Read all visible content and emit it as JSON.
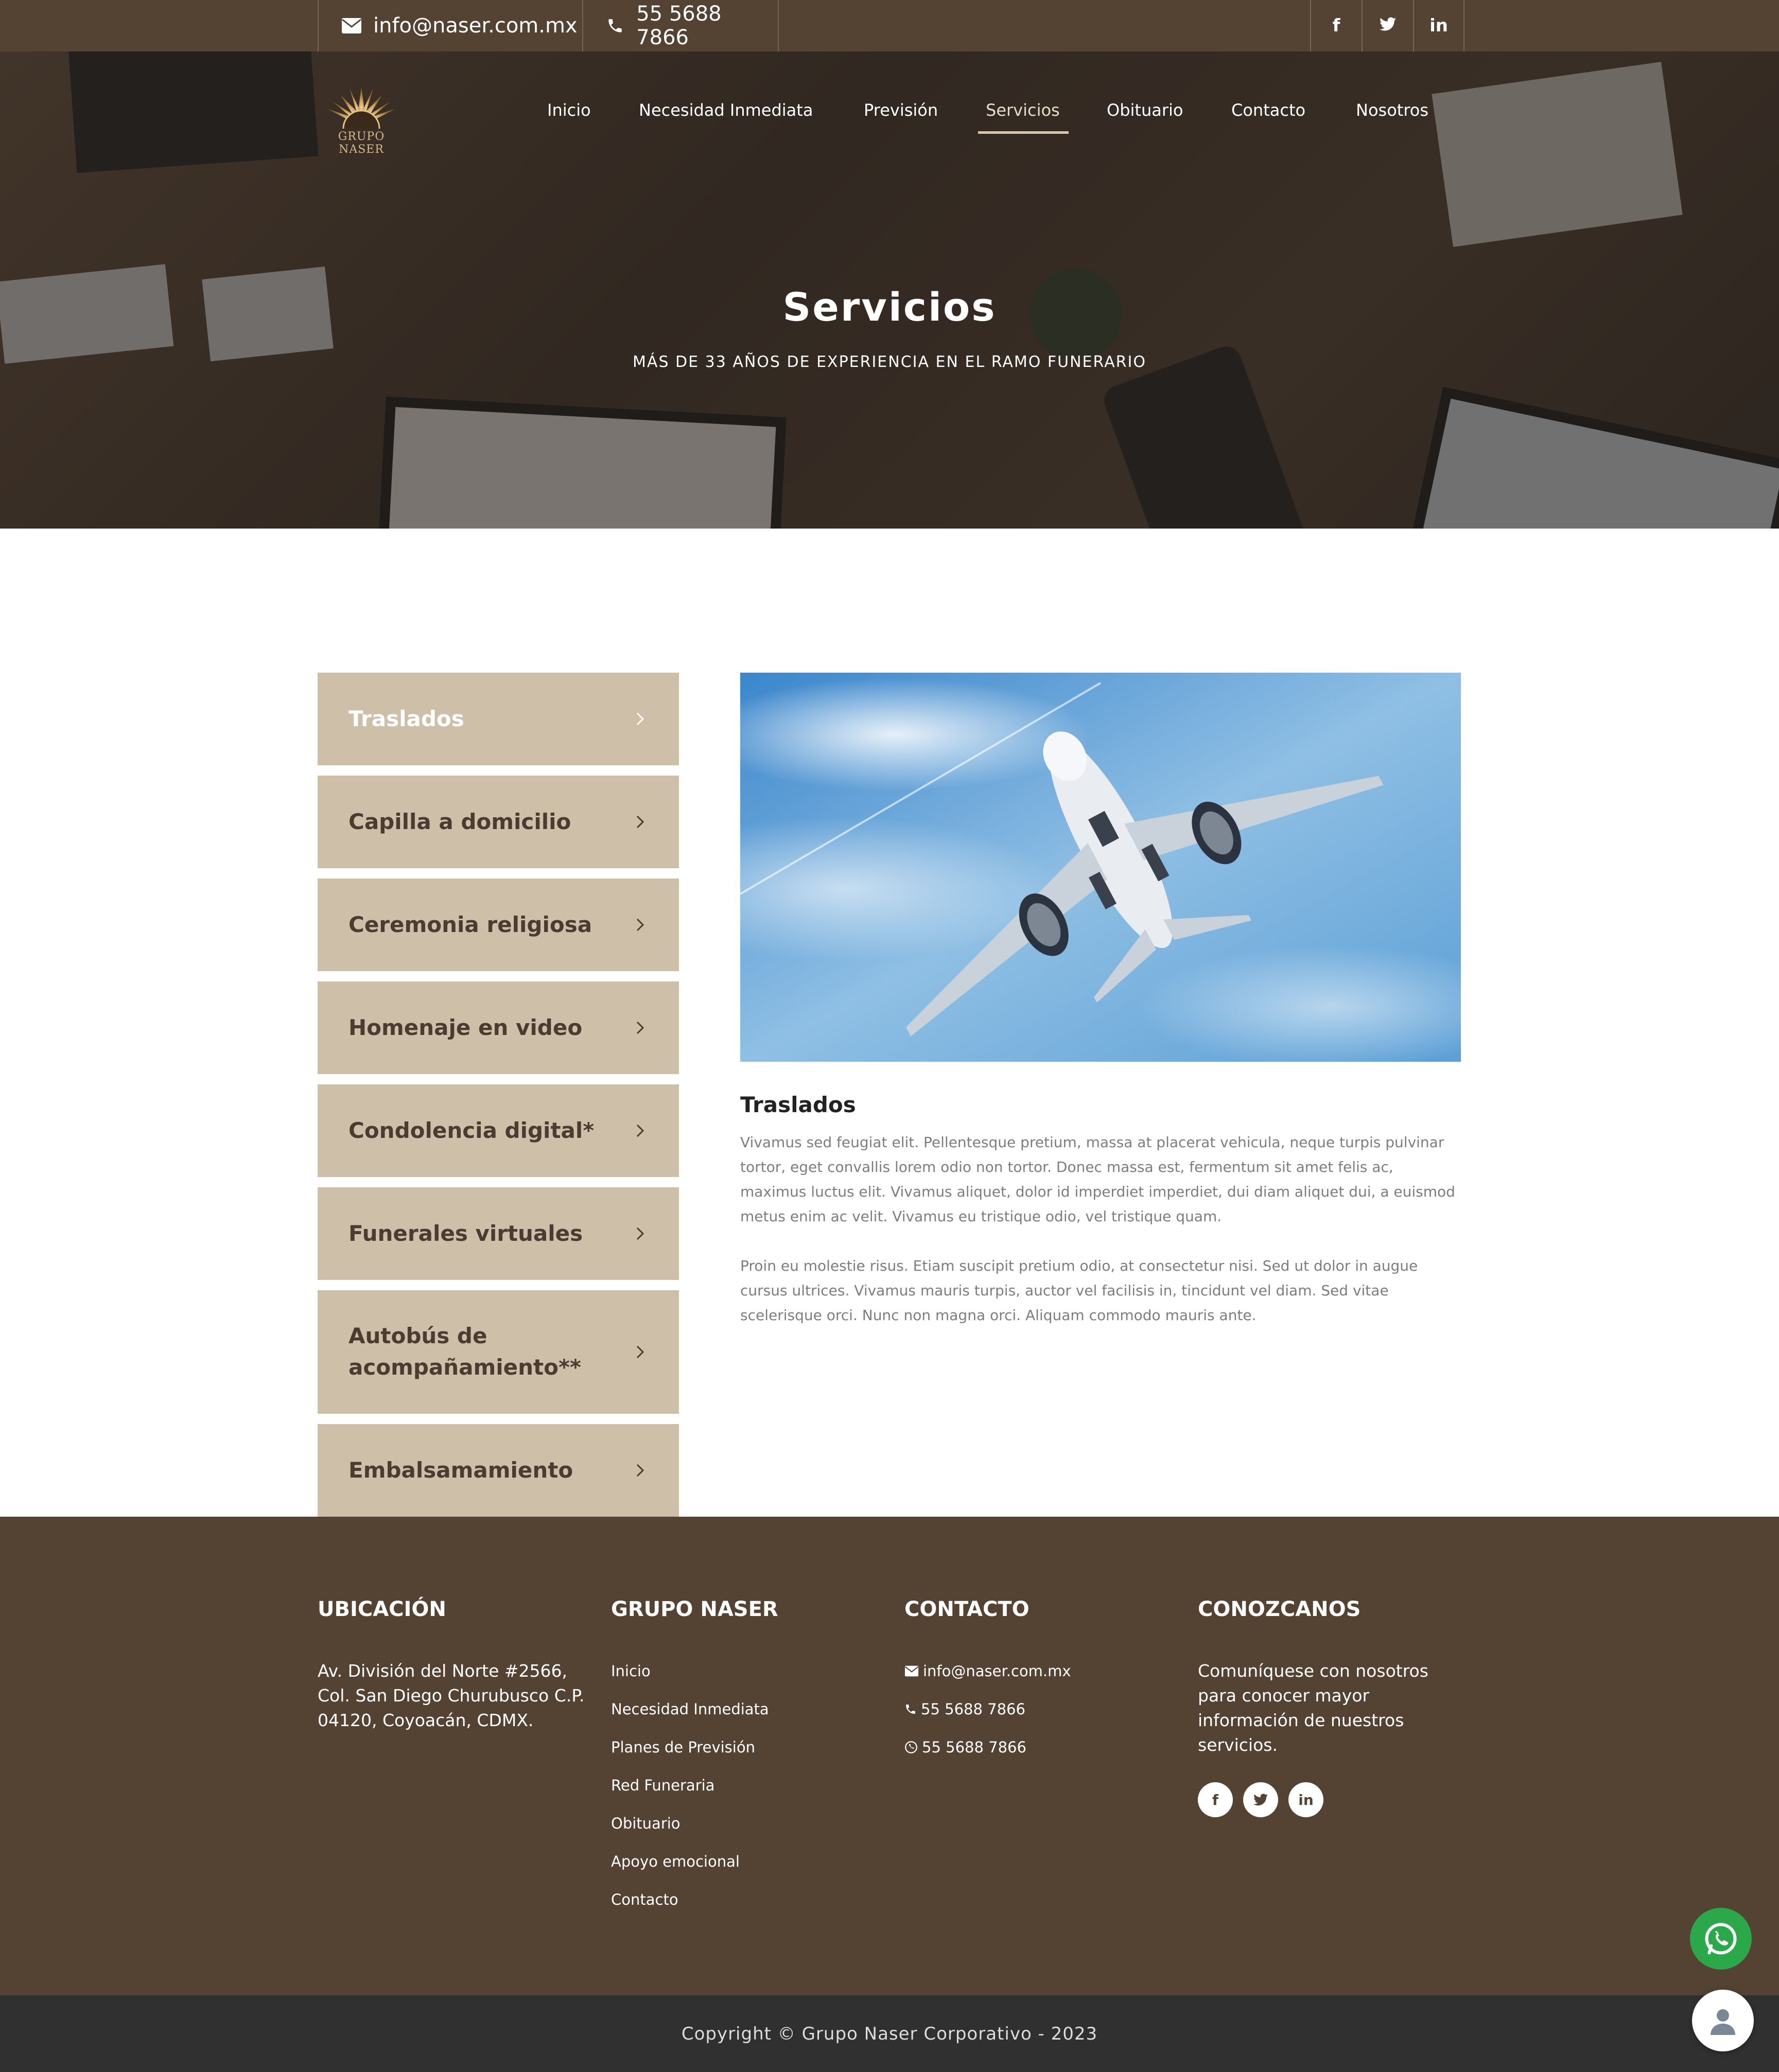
{
  "topbar": {
    "email": "info@naser.com.mx",
    "phone": "55 5688 7866",
    "social_icons": [
      "facebook-icon",
      "twitter-icon",
      "linkedin-icon"
    ],
    "social_labels": [
      "f",
      "",
      "in"
    ]
  },
  "brand": {
    "logo_text": "GRUPO NASER"
  },
  "nav": {
    "items": [
      "Inicio",
      "Necesidad Inmediata",
      "Previsión",
      "Servicios",
      "Obituario",
      "Contacto",
      "Nosotros"
    ],
    "active": "Servicios"
  },
  "hero": {
    "title": "Servicios",
    "subtitle": "MÁS DE 33 AÑOS DE EXPERIENCIA EN EL RAMO FUNERARIO"
  },
  "services": {
    "items": [
      "Traslados",
      "Capilla a domicilio",
      "Ceremonia religiosa",
      "Homenaje en video",
      "Condolencia digital*",
      "Funerales virtuales",
      "Autobús de acompañamiento**",
      "Embalsamamiento"
    ],
    "active": "Traslados"
  },
  "content": {
    "title": "Traslados",
    "paragraphs": [
      "Vivamus sed feugiat elit. Pellentesque pretium, massa at placerat vehicula, neque turpis pulvinar tortor, eget convallis lorem odio non tortor. Donec massa est, fermentum sit amet felis ac, maximus luctus elit. Vivamus aliquet, dolor id imperdiet imperdiet, dui diam aliquet dui, a euismod metus enim ac velit. Vivamus eu tristique odio, vel tristique quam.",
      "Proin eu molestie risus. Etiam suscipit pretium odio, at consectetur nisi. Sed ut dolor in augue cursus ultrices. Vivamus mauris turpis, auctor vel facilisis in, tincidunt vel diam. Sed vitae scelerisque orci. Nunc non magna orci. Aliquam commodo mauris ante."
    ]
  },
  "footer": {
    "location": {
      "heading": "UBICACIÓN",
      "address_lines": [
        "Av. División del Norte #2566,",
        "Col. San Diego Churubusco C.P.",
        "04120, Coyoacán, CDMX."
      ]
    },
    "grupo": {
      "heading": "GRUPO NASER",
      "links": [
        "Inicio",
        "Necesidad Inmediata",
        "Planes de Previsión",
        "Red Funeraria",
        "Obituario",
        "Apoyo emocional",
        "Contacto"
      ]
    },
    "contact": {
      "heading": "CONTACTO",
      "email": "info@naser.com.mx",
      "phone": "55 5688 7866",
      "whatsapp": "55 5688 7866"
    },
    "about": {
      "heading": "CONOZCANOS",
      "text_lines": [
        "Comuníquese con nosotros",
        "para conocer mayor",
        "información de nuestros",
        "servicios."
      ],
      "social_icons": [
        "facebook-icon",
        "twitter-icon",
        "linkedin-icon"
      ],
      "social_labels": [
        "f",
        "",
        "in"
      ]
    },
    "copyright": "Copyright © Grupo Naser Corporativo - 2023"
  },
  "colors": {
    "brand_brown": "#544233",
    "sidebar_tan": "#cebfa9",
    "whatsapp_green": "#2ba84a",
    "copyright_bar": "#303030"
  }
}
